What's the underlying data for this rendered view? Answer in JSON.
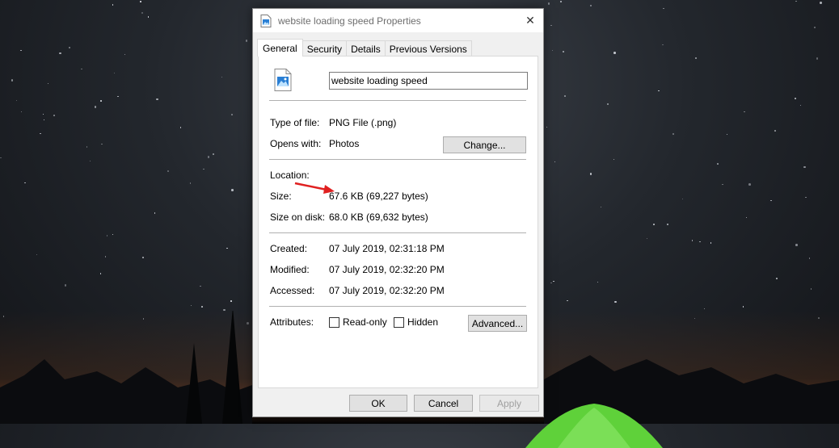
{
  "window": {
    "title": "website loading speed Properties",
    "close_glyph": "✕"
  },
  "tabs": [
    {
      "label": "General",
      "active": true
    },
    {
      "label": "Security",
      "active": false
    },
    {
      "label": "Details",
      "active": false
    },
    {
      "label": "Previous Versions",
      "active": false
    }
  ],
  "general": {
    "file_name": "website loading speed",
    "file_icon": "image-file-icon",
    "type_label": "Type of file:",
    "type_value": "PNG File (.png)",
    "opens_label": "Opens with:",
    "opens_value": "Photos",
    "change_button": "Change...",
    "location_label": "Location:",
    "location_value": "",
    "size_label": "Size:",
    "size_value": "67.6 KB (69,227 bytes)",
    "size_on_disk_label": "Size on disk:",
    "size_on_disk_value": "68.0 KB (69,632 bytes)",
    "created_label": "Created:",
    "created_value": "07 July 2019, 02:31:18 PM",
    "modified_label": "Modified:",
    "modified_value": "07 July 2019, 02:32:20 PM",
    "accessed_label": "Accessed:",
    "accessed_value": "07 July 2019, 02:32:20 PM",
    "attributes_label": "Attributes:",
    "readonly_label": "Read-only",
    "readonly_checked": false,
    "hidden_label": "Hidden",
    "hidden_checked": false,
    "advanced_button": "Advanced..."
  },
  "footer": {
    "ok": "OK",
    "cancel": "Cancel",
    "apply": "Apply"
  },
  "colors": {
    "annotation_arrow": "#e02020",
    "tent": "#5fd13a"
  }
}
